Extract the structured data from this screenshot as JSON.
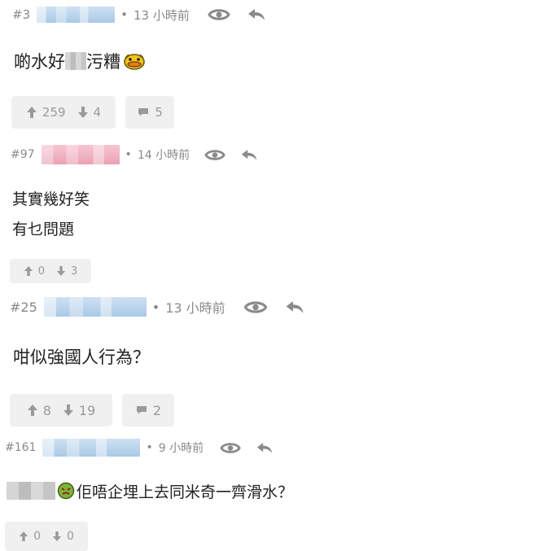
{
  "comments": [
    {
      "floor": "#3",
      "separator": "•",
      "time": "13 小時前",
      "body": {
        "line1_before": "啲水好",
        "line1_after": "污糟"
      },
      "votes": {
        "up": "259",
        "down": "4"
      },
      "replies": "5",
      "username_color": "blue",
      "body_icons": [
        "censor-block",
        "emoji-duck-icon"
      ]
    },
    {
      "floor": "#97",
      "separator": "•",
      "time": "14 小時前",
      "body": {
        "line1": "其實幾好笑",
        "line2": "有乜問題"
      },
      "votes": {
        "up": "0",
        "down": "3"
      },
      "username_color": "pink"
    },
    {
      "floor": "#25",
      "separator": "•",
      "time": "13 小時前",
      "body": {
        "line1": "咁似強國人行為？"
      },
      "votes": {
        "up": "8",
        "down": "19"
      },
      "replies": "2",
      "username_color": "blue"
    },
    {
      "floor": "#161",
      "separator": "•",
      "time": "9 小時前",
      "body": {
        "line1_after": "佢唔企埋上去同米奇一齊滑水？"
      },
      "votes": {
        "up": "0",
        "down": "0"
      },
      "username_color": "blue",
      "body_icons": [
        "censor-block",
        "emoji-sick-icon"
      ]
    }
  ],
  "icons": {
    "view": "eye-icon",
    "reply": "reply-icon",
    "upvote": "thumb-arrow-up-icon",
    "downvote": "thumb-arrow-down-icon",
    "replies": "speech-bubble-icon"
  },
  "colors": {
    "meta_text": "#8a8a8a",
    "body_text": "#222222",
    "vote_bg": "#f0f0f0",
    "vote_text": "#9a9a9a",
    "username_blue": "#a9c9e6",
    "username_pink": "#e9a2b4"
  }
}
